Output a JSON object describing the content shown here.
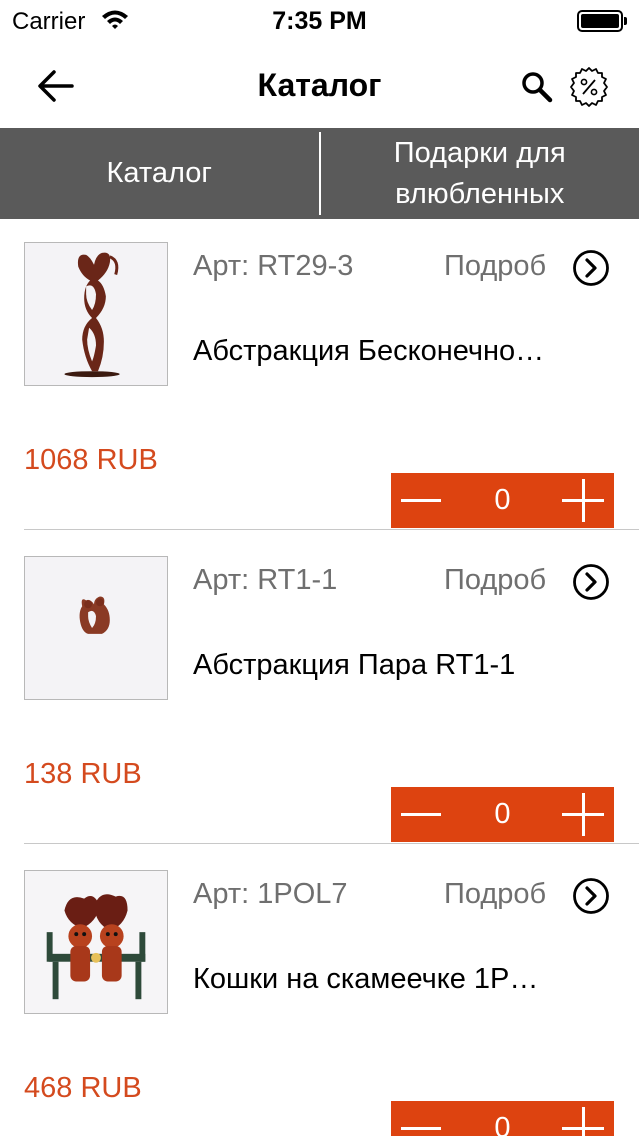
{
  "status_bar": {
    "carrier": "Carrier",
    "time": "7:35 PM",
    "wifi_icon": "wifi-icon",
    "battery_icon": "battery-icon"
  },
  "nav": {
    "title": "Каталог",
    "back_icon": "back-arrow-icon",
    "search_icon": "search-icon",
    "discount_icon": "discount-badge-icon"
  },
  "tabs": [
    {
      "label": "Каталог"
    },
    {
      "label": "Подарки для влюбленных"
    }
  ],
  "products": [
    {
      "sku": "Арт: RT29-3",
      "details": "Подроб",
      "name": "Абстракция Бесконечно…",
      "price": "1068 RUB",
      "quantity": "0"
    },
    {
      "sku": "Арт: RT1-1",
      "details": "Подроб",
      "name": "Абстракция Пара RT1-1",
      "price": "138 RUB",
      "quantity": "0"
    },
    {
      "sku": "Арт: 1POL7",
      "details": "Подроб",
      "name": "Кошки на скамеечке 1P…",
      "price": "468 RUB",
      "quantity": "0"
    }
  ],
  "colors": {
    "accent": "#dd4310",
    "price": "#d44a1e",
    "tab_bar": "#5a5a5a"
  }
}
